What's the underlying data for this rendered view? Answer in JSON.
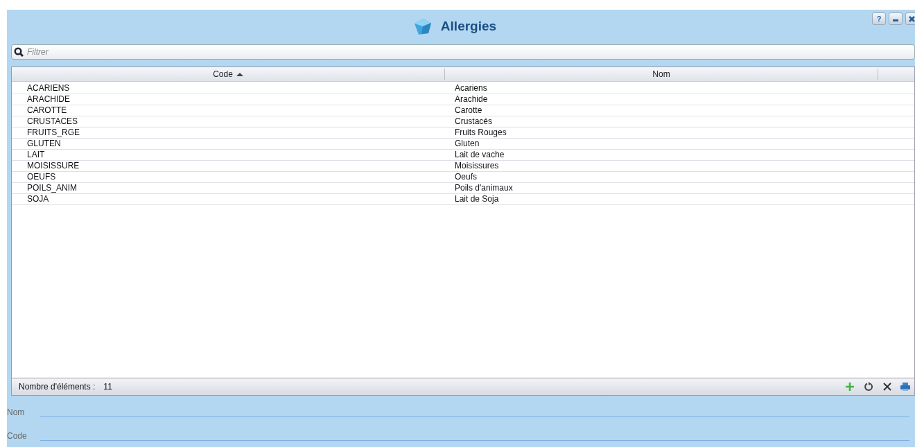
{
  "window": {
    "title": "Allergies",
    "help_label": "?"
  },
  "filter": {
    "placeholder": "Filtrer"
  },
  "table": {
    "columns": [
      {
        "label": "Code",
        "sorted": true
      },
      {
        "label": "Nom",
        "sorted": false
      }
    ],
    "rows": [
      [
        "ACARIENS",
        "Acariens"
      ],
      [
        "ARACHIDE",
        "Arachide"
      ],
      [
        "CAROTTE",
        "Carotte"
      ],
      [
        "CRUSTACES",
        "Crustacés"
      ],
      [
        "FRUITS_RGE",
        "Fruits Rouges"
      ],
      [
        "GLUTEN",
        "Gluten"
      ],
      [
        "LAIT",
        "Lait de vache"
      ],
      [
        "MOISISSURE",
        "Moisissures"
      ],
      [
        "OEUFS",
        "Oeufs"
      ],
      [
        "POILS_ANIM",
        "Poils d'animaux"
      ],
      [
        "SOJA",
        "Lait de Soja"
      ]
    ]
  },
  "status_bar": {
    "count_label": "Nombre d'éléments :",
    "count": "11"
  },
  "form": [
    {
      "label": "Nom"
    },
    {
      "label": "Code"
    }
  ]
}
